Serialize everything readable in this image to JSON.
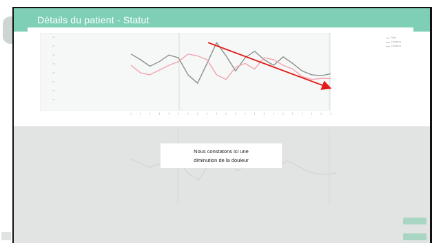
{
  "header": {
    "title": "Détails du patient - Statut"
  },
  "chart_top": {
    "legend": [
      "Mal",
      "Douleur",
      "Douleur"
    ]
  },
  "annotation": {
    "line1": "Nous constatons ici une",
    "line2": "diminution de la douleur"
  },
  "buttons": [
    "",
    ""
  ],
  "colors": {
    "header": "#7fcfb7",
    "overlay": "#e2e4e3",
    "arrow": "#e41a1a",
    "series_gray": "#8a8f8c",
    "series_pink": "#f2a3b0"
  },
  "chart_data": {
    "type": "line",
    "series": [
      {
        "values": [
          5.2,
          4.6,
          3.9,
          4.4,
          5.1,
          4.8,
          3.0,
          2.1,
          4.2,
          6.4,
          5.0,
          3.4,
          4.8,
          5.5,
          4.6,
          4.0,
          4.9,
          4.2,
          3.4,
          3.0,
          2.9,
          3.1
        ]
      },
      {
        "values": [
          4.0,
          3.2,
          3.0,
          3.5,
          4.0,
          4.4,
          5.2,
          5.0,
          4.6,
          3.0,
          2.5,
          3.8,
          4.2,
          3.6,
          4.8,
          4.6,
          4.0,
          3.6,
          2.8,
          2.5,
          2.6,
          2.6
        ]
      }
    ]
  }
}
